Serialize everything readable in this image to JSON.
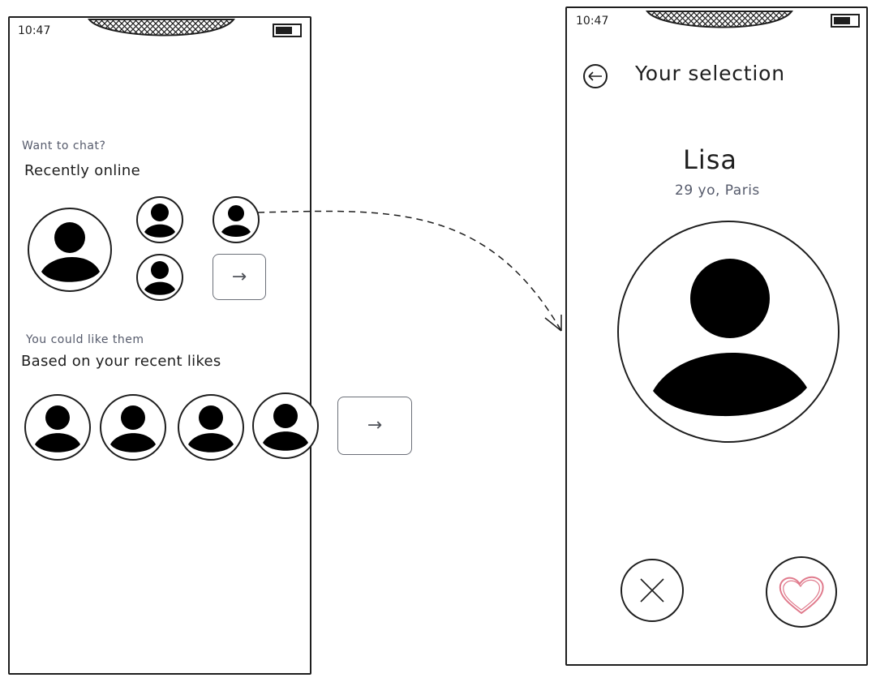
{
  "left_screen": {
    "time": "10:47",
    "section1": {
      "subtitle": "Want to chat?",
      "title": "Recently online"
    },
    "section2": {
      "subtitle": "You could like them",
      "title": "Based on your recent likes"
    },
    "arrow_label": "→"
  },
  "right_screen": {
    "time": "10:47",
    "back_icon": "←",
    "title": "Your selection",
    "name": "Lisa",
    "details": "29 yo, Paris"
  },
  "colors": {
    "stroke": "#1e1e1e",
    "muted": "#555a6b",
    "heart": "#e07a8c"
  },
  "icons": [
    "battery-icon",
    "notch",
    "avatar-icon",
    "arrow-right-icon",
    "back-arrow-icon",
    "close-icon",
    "heart-icon"
  ]
}
